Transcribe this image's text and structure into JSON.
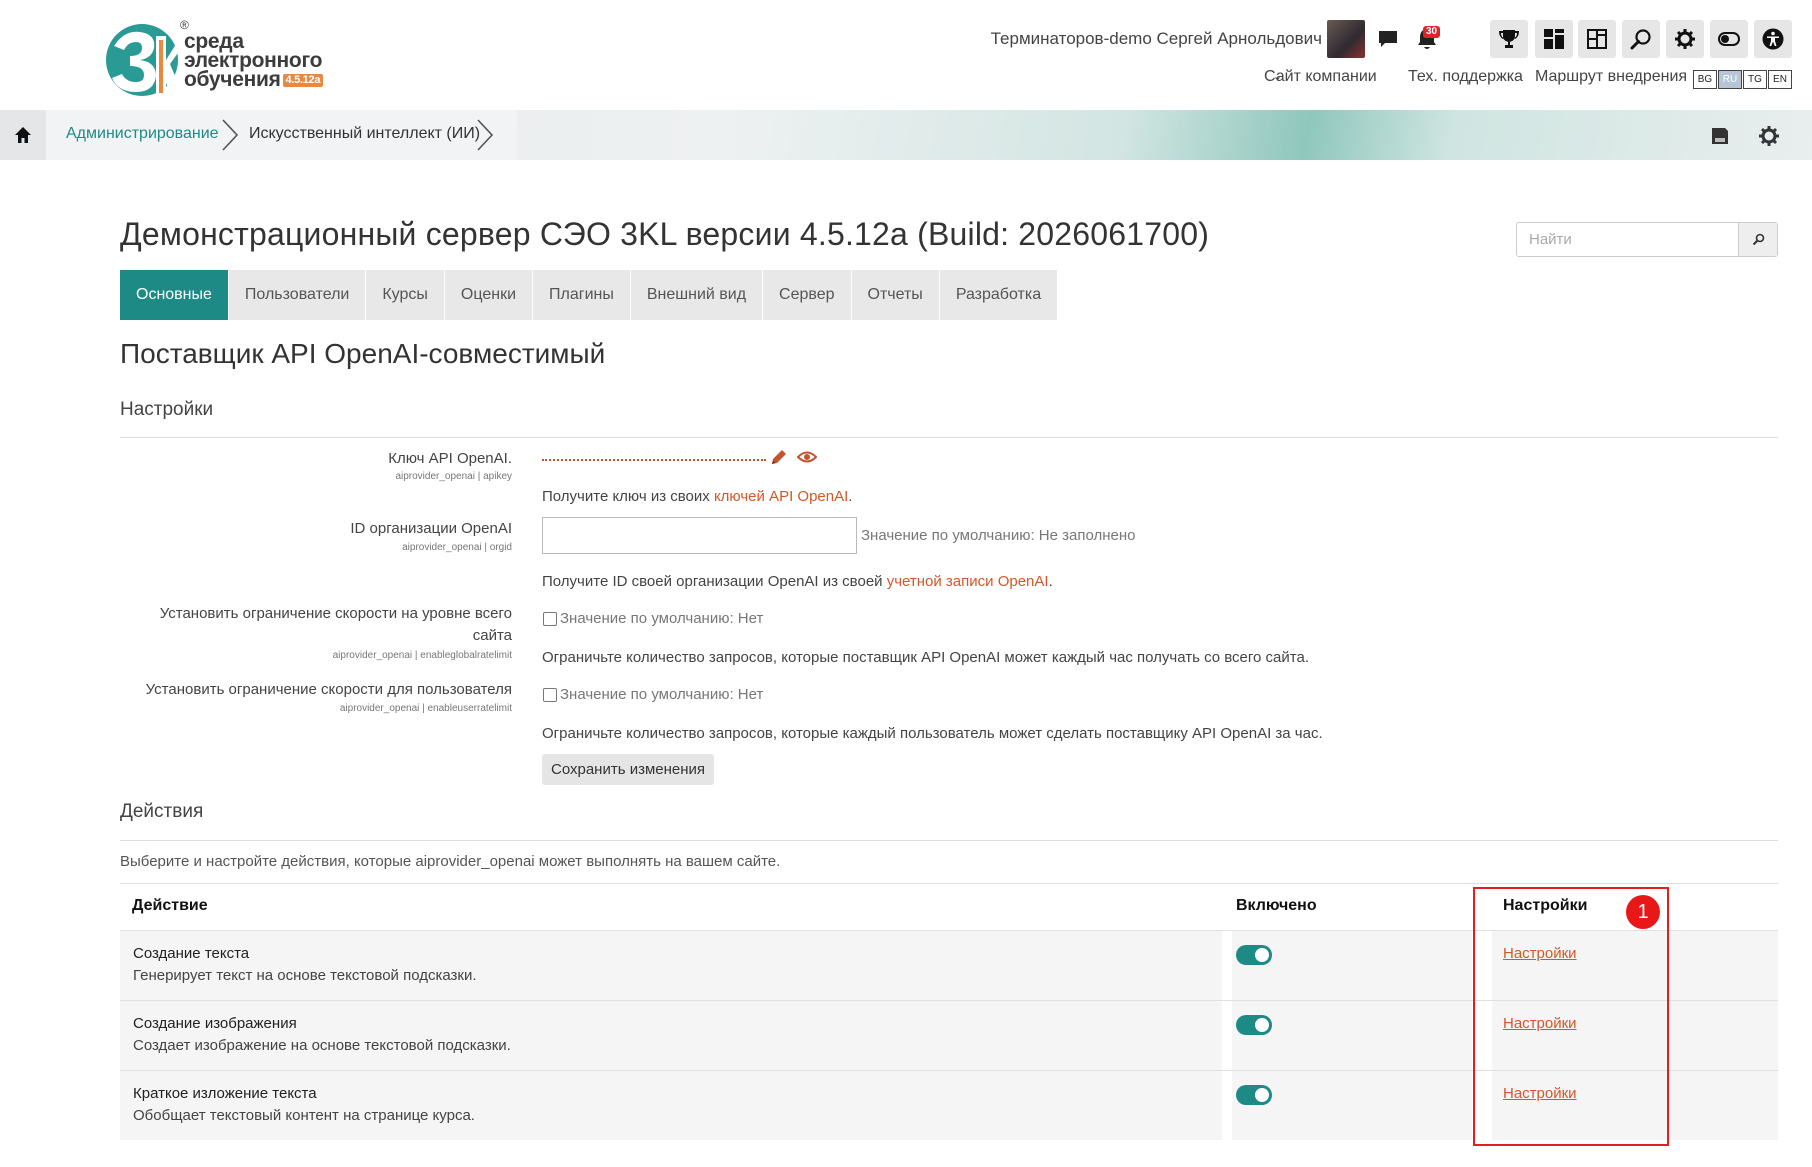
{
  "brand": {
    "name_line1": "среда",
    "name_line2": "электронного",
    "name_line3": "обучения",
    "version": "4.5.12a",
    "registered": "®"
  },
  "header": {
    "username": "Терминаторов-demo Сергей Арнольдович",
    "notification_count": "30",
    "nav": {
      "company_site": "Сайт компании",
      "support": "Тех. поддержка",
      "roadmap": "Маршрут внедрения"
    },
    "languages": [
      "BG",
      "RU",
      "TG",
      "EN"
    ],
    "active_language": "RU",
    "icons": [
      "message-icon",
      "bell-icon",
      "trophy-icon",
      "dashboard-icon",
      "layout-icon",
      "search-icon",
      "gear-icon",
      "toggle-icon",
      "accessibility-icon"
    ]
  },
  "breadcrumb": {
    "items": [
      "Администрирование",
      "Искусственный интеллект (ИИ)"
    ]
  },
  "page": {
    "title": "Демонстрационный сервер СЭО 3KL версии 4.5.12a (Build: 2026061700)",
    "search_placeholder": "Найти",
    "tabs": [
      "Основные",
      "Пользователи",
      "Курсы",
      "Оценки",
      "Плагины",
      "Внешний вид",
      "Сервер",
      "Отчеты",
      "Разработка"
    ],
    "active_tab": "Основные",
    "subtitle": "Поставщик API OpenAI-совместимый"
  },
  "settings": {
    "heading": "Настройки",
    "apikey": {
      "label": "Ключ API OpenAI.",
      "sub": "aiprovider_openai | apikey",
      "desc_prefix": "Получите ключ из своих ",
      "desc_link": "ключей API OpenAI",
      "desc_suffix": "."
    },
    "orgid": {
      "label": "ID организации OpenAI",
      "sub": "aiprovider_openai | orgid",
      "value": "",
      "default": "Значение по умолчанию: Не заполнено",
      "desc_prefix": "Получите ID своей организации OpenAI из своей ",
      "desc_link": "учетной записи OpenAI",
      "desc_suffix": "."
    },
    "globalratelimit": {
      "label_line1": "Установить ограничение скорости на уровне всего",
      "label_line2": "сайта",
      "sub": "aiprovider_openai | enableglobalratelimit",
      "default": "Значение по умолчанию: Нет",
      "checked": false,
      "desc": "Ограничьте количество запросов, которые поставщик API OpenAI может каждый час получать со всего сайта."
    },
    "userratelimit": {
      "label": "Установить ограничение скорости для пользователя",
      "sub": "aiprovider_openai | enableuserratelimit",
      "default": "Значение по умолчанию: Нет",
      "checked": false,
      "desc": "Ограничьте количество запросов, которые каждый пользователь может сделать поставщику API OpenAI за час."
    },
    "save_label": "Сохранить изменения"
  },
  "actions": {
    "heading": "Действия",
    "intro": "Выберите и настройте действия, которые aiprovider_openai может выполнять на вашем сайте.",
    "columns": [
      "Действие",
      "Включено",
      "Настройки"
    ],
    "rows": [
      {
        "name": "Создание текста",
        "desc": "Генерирует текст на основе текстовой подсказки.",
        "enabled": true,
        "settings": "Настройки"
      },
      {
        "name": "Создание изображения",
        "desc": "Создает изображение на основе текстовой подсказки.",
        "enabled": true,
        "settings": "Настройки"
      },
      {
        "name": "Краткое изложение текста",
        "desc": "Обобщает текстовый контент на странице курса.",
        "enabled": true,
        "settings": "Настройки"
      }
    ]
  },
  "annotation": {
    "marker": "1",
    "color": "#e02020"
  },
  "colors": {
    "accent": "#1d8a86",
    "link": "#d1582a",
    "brand_orange": "#e9883f"
  }
}
